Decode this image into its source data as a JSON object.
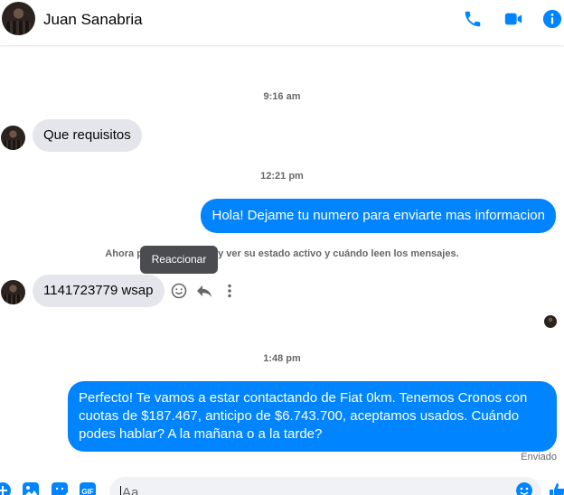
{
  "header": {
    "contact_name": "Juan Sanabria",
    "icons": [
      "phone-icon",
      "video-camera-icon",
      "info-icon"
    ],
    "accent_color": "#0084ff"
  },
  "messages": {
    "stamp_1": "9:16 am",
    "msg_1": "Que requisitos",
    "stamp_2": "12:21 pm",
    "msg_2": "Hola! Dejame tu numero para enviarte mas informacion",
    "notice": "Ahora pueden llamarse y ver su estado activo y cuándo leen los mensajes.",
    "msg_3": "1141723779 wsap",
    "tooltip": "Reaccionar",
    "stamp_3": "1:48 pm",
    "msg_4": "Perfecto! Te vamos a estar contactando de Fiat 0km. Tenemos Cronos con cuotas de $187.467, anticipo de $6.743.700, aceptamos usados. Cuándo podes hablar? A la mañana o a la tarde?",
    "status": "Enviado"
  },
  "composer": {
    "placeholder": "Aa",
    "icons": [
      "plus-icon",
      "image-icon",
      "sticker-icon",
      "gif-icon",
      "emoji-icon",
      "like-icon"
    ]
  }
}
